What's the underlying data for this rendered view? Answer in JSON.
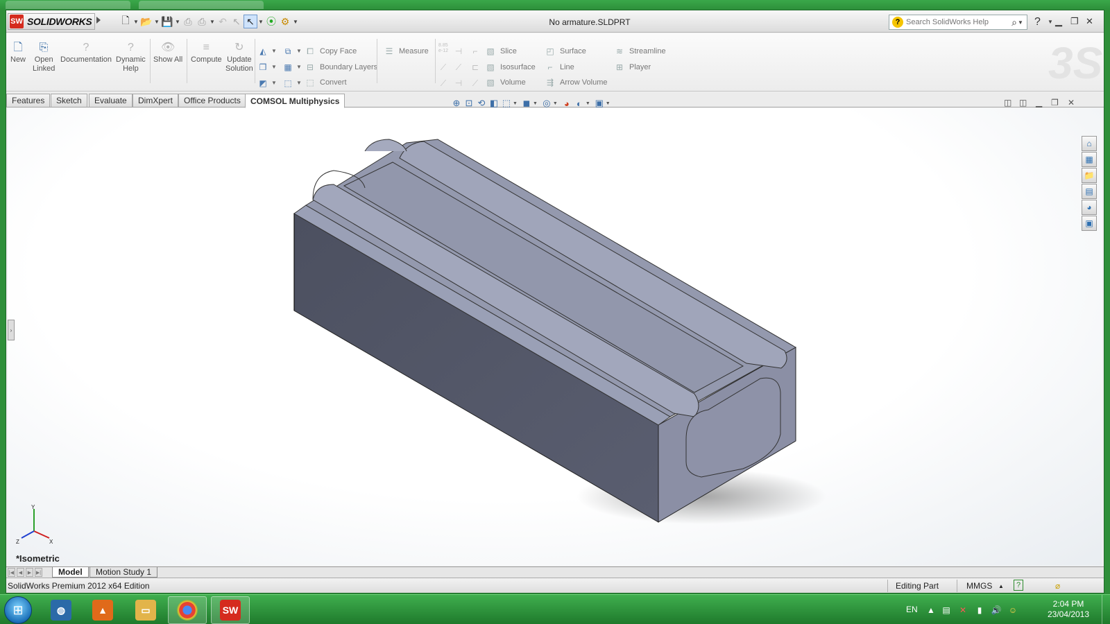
{
  "window": {
    "app_name": "SOLIDWORKS",
    "app_logo_text": "SW",
    "document_title": "No armature.SLDPRT",
    "search_placeholder": "Search SolidWorks Help"
  },
  "ribbon": {
    "buttons": [
      {
        "label": "New",
        "icon": "new-doc-icon"
      },
      {
        "label": "Open\nLinked",
        "icon": "open-linked-icon"
      },
      {
        "label": "Documentation",
        "icon": "documentation-icon"
      },
      {
        "label": "Dynamic\nHelp",
        "icon": "dynamic-help-icon"
      },
      {
        "label": "Show All",
        "icon": "show-all-icon"
      },
      {
        "label": "Compute",
        "icon": "compute-icon"
      },
      {
        "label": "Update\nSolution",
        "icon": "update-solution-icon"
      }
    ],
    "geometry_items": [
      "Copy Face",
      "Boundary Layers",
      "Convert"
    ],
    "measure_label": "Measure",
    "plot_items_col1": [
      "Slice",
      "Isosurface",
      "Volume"
    ],
    "plot_items_col2": [
      "Surface",
      "Line",
      "Arrow Volume"
    ],
    "plot_items_col3": [
      "Streamline",
      "Player"
    ],
    "numeric_label": "8.85\ne-12"
  },
  "tabs": [
    "Features",
    "Sketch",
    "Evaluate",
    "DimXpert",
    "Office Products",
    "COMSOL Multiphysics"
  ],
  "active_tab": "COMSOL Multiphysics",
  "viewport": {
    "view_name": "*Isometric",
    "triad_labels": {
      "x": "X",
      "y": "Y",
      "z": "Z"
    }
  },
  "bottom_tabs": [
    "Model",
    "Motion Study 1"
  ],
  "statusbar": {
    "edition": "SolidWorks Premium 2012 x64 Edition",
    "mode": "Editing Part",
    "units": "MMGS"
  },
  "taskbar": {
    "language": "EN",
    "time": "2:04 PM",
    "date": "23/04/2013"
  },
  "colors": {
    "model_face": "#8e92a8",
    "model_top": "#9da2b8",
    "model_side": "#545868",
    "taskbar": "#2f9b40"
  }
}
